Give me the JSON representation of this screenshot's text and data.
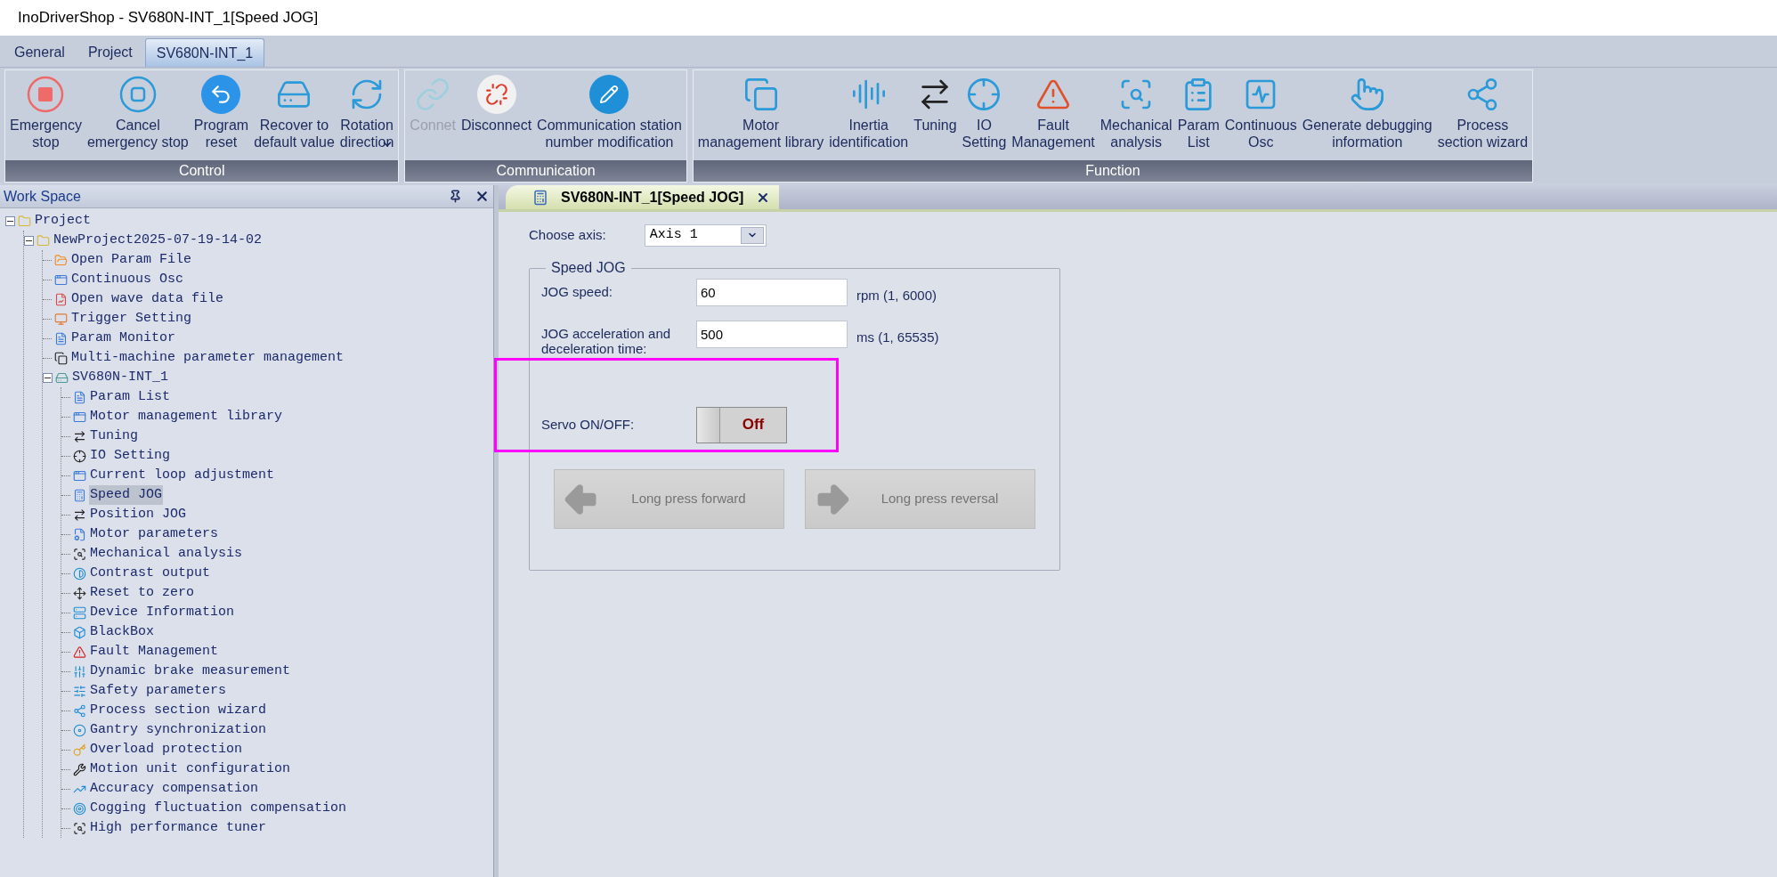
{
  "window": {
    "title": "InoDriverShop - SV680N-INT_1[Speed JOG]"
  },
  "ribbon": {
    "tabs": [
      {
        "label": "General",
        "selected": false
      },
      {
        "label": "Project",
        "selected": false
      },
      {
        "label": "SV680N-INT_1",
        "selected": true
      }
    ],
    "groups": [
      {
        "title": "Control",
        "buttons": [
          {
            "label": "Emergency\nstop",
            "disabled": false,
            "has_menu": false
          },
          {
            "label": "Cancel\nemergency stop",
            "disabled": false,
            "has_menu": false
          },
          {
            "label": "Program\nreset",
            "disabled": false,
            "has_menu": false
          },
          {
            "label": "Recover to\ndefault value",
            "disabled": false,
            "has_menu": false
          },
          {
            "label": "Rotation\ndirection",
            "disabled": false,
            "has_menu": true
          }
        ]
      },
      {
        "title": "Communication",
        "buttons": [
          {
            "label": "Connet",
            "disabled": true,
            "has_menu": false
          },
          {
            "label": "Disconnect",
            "disabled": false,
            "has_menu": false
          },
          {
            "label": "Communication station\nnumber modification",
            "disabled": false,
            "has_menu": false
          }
        ]
      },
      {
        "title": "Function",
        "buttons": [
          {
            "label": "Motor\nmanagement library",
            "disabled": false,
            "has_menu": false
          },
          {
            "label": "Inertia\nidentification",
            "disabled": false,
            "has_menu": false
          },
          {
            "label": "Tuning",
            "disabled": false,
            "has_menu": false
          },
          {
            "label": "IO\nSetting",
            "disabled": false,
            "has_menu": false
          },
          {
            "label": "Fault\nManagement",
            "disabled": false,
            "has_menu": false
          },
          {
            "label": "Mechanical\nanalysis",
            "disabled": false,
            "has_menu": false
          },
          {
            "label": "Param\nList",
            "disabled": false,
            "has_menu": false
          },
          {
            "label": "Continuous\nOsc",
            "disabled": false,
            "has_menu": false
          },
          {
            "label": "Generate debugging\ninformation",
            "disabled": false,
            "has_menu": false
          },
          {
            "label": "Process\nsection wizard",
            "disabled": false,
            "has_menu": false
          }
        ]
      }
    ]
  },
  "workspace": {
    "title": "Work Space",
    "tree": [
      {
        "label": "Project",
        "expanded": true,
        "selected": false,
        "children": [
          {
            "label": "NewProject2025-07-19-14-02",
            "expanded": true,
            "selected": false,
            "children": [
              {
                "label": "Open Param File",
                "selected": false
              },
              {
                "label": "Continuous Osc",
                "selected": false
              },
              {
                "label": "Open wave data file",
                "selected": false
              },
              {
                "label": "Trigger Setting",
                "selected": false
              },
              {
                "label": "Param Monitor",
                "selected": false
              },
              {
                "label": "Multi-machine parameter management",
                "selected": false
              },
              {
                "label": "SV680N-INT_1",
                "expanded": true,
                "selected": false,
                "children": [
                  {
                    "label": "Param List",
                    "selected": false
                  },
                  {
                    "label": "Motor management library",
                    "selected": false
                  },
                  {
                    "label": "Tuning",
                    "selected": false
                  },
                  {
                    "label": "IO Setting",
                    "selected": false
                  },
                  {
                    "label": "Current loop adjustment",
                    "selected": false
                  },
                  {
                    "label": "Speed JOG",
                    "selected": true
                  },
                  {
                    "label": "Position JOG",
                    "selected": false
                  },
                  {
                    "label": "Motor parameters",
                    "selected": false
                  },
                  {
                    "label": "Mechanical analysis",
                    "selected": false
                  },
                  {
                    "label": "Contrast output",
                    "selected": false
                  },
                  {
                    "label": "Reset to zero",
                    "selected": false
                  },
                  {
                    "label": "Device Information",
                    "selected": false
                  },
                  {
                    "label": "BlackBox",
                    "selected": false
                  },
                  {
                    "label": "Fault Management",
                    "selected": false
                  },
                  {
                    "label": "Dynamic brake measurement",
                    "selected": false
                  },
                  {
                    "label": "Safety parameters",
                    "selected": false
                  },
                  {
                    "label": "Process section wizard",
                    "selected": false
                  },
                  {
                    "label": "Gantry synchronization",
                    "selected": false
                  },
                  {
                    "label": "Overload protection",
                    "selected": false
                  },
                  {
                    "label": "Motion unit configuration",
                    "selected": false
                  },
                  {
                    "label": "Accuracy compensation",
                    "selected": false
                  },
                  {
                    "label": "Cogging fluctuation compensation",
                    "selected": false
                  },
                  {
                    "label": "High performance tuner",
                    "selected": false
                  }
                ]
              }
            ]
          }
        ]
      }
    ]
  },
  "document": {
    "tab": {
      "label": "SV680N-INT_1[Speed JOG]",
      "selected": true
    },
    "axis": {
      "label": "Choose axis:",
      "value": "Axis 1"
    },
    "group": {
      "title": "Speed JOG",
      "fields": [
        {
          "label": "JOG speed:",
          "value": "60",
          "range": "rpm (1, 6000)"
        },
        {
          "label": "JOG acceleration and deceleration time:",
          "value": "500",
          "range": "ms (1, 65535)"
        }
      ],
      "servo": {
        "label": "Servo ON/OFF:",
        "state": "Off",
        "on": false
      },
      "buttons": [
        {
          "label": "Long press forward",
          "kind": "left",
          "disabled": true
        },
        {
          "label": "Long press reversal",
          "kind": "right",
          "disabled": true
        }
      ]
    }
  },
  "annotation": {
    "kind": "highlight",
    "color": "#ff00ff"
  }
}
